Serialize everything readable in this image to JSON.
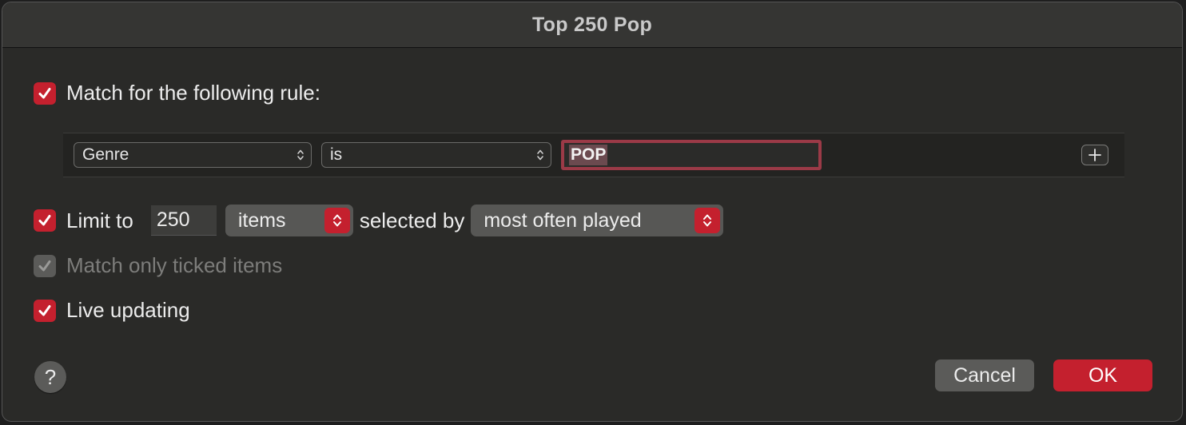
{
  "window": {
    "title": "Top 250 Pop"
  },
  "match_rule": {
    "checked": true,
    "label": "Match for the following rule:"
  },
  "rule": {
    "field": "Genre",
    "operator": "is",
    "value": "POP",
    "add_icon": "plus-icon"
  },
  "limit": {
    "checked": true,
    "label": "Limit to",
    "value": "250",
    "unit": "items",
    "selected_by_label": "selected by",
    "selected_by": "most often played"
  },
  "match_ticked": {
    "checked": true,
    "enabled": false,
    "label": "Match only ticked items"
  },
  "live_updating": {
    "checked": true,
    "label": "Live updating"
  },
  "footer": {
    "help_label": "?",
    "cancel_label": "Cancel",
    "ok_label": "OK"
  },
  "colors": {
    "accent": "#c4202e",
    "background": "#2a2a28",
    "titlebar": "#353533"
  }
}
